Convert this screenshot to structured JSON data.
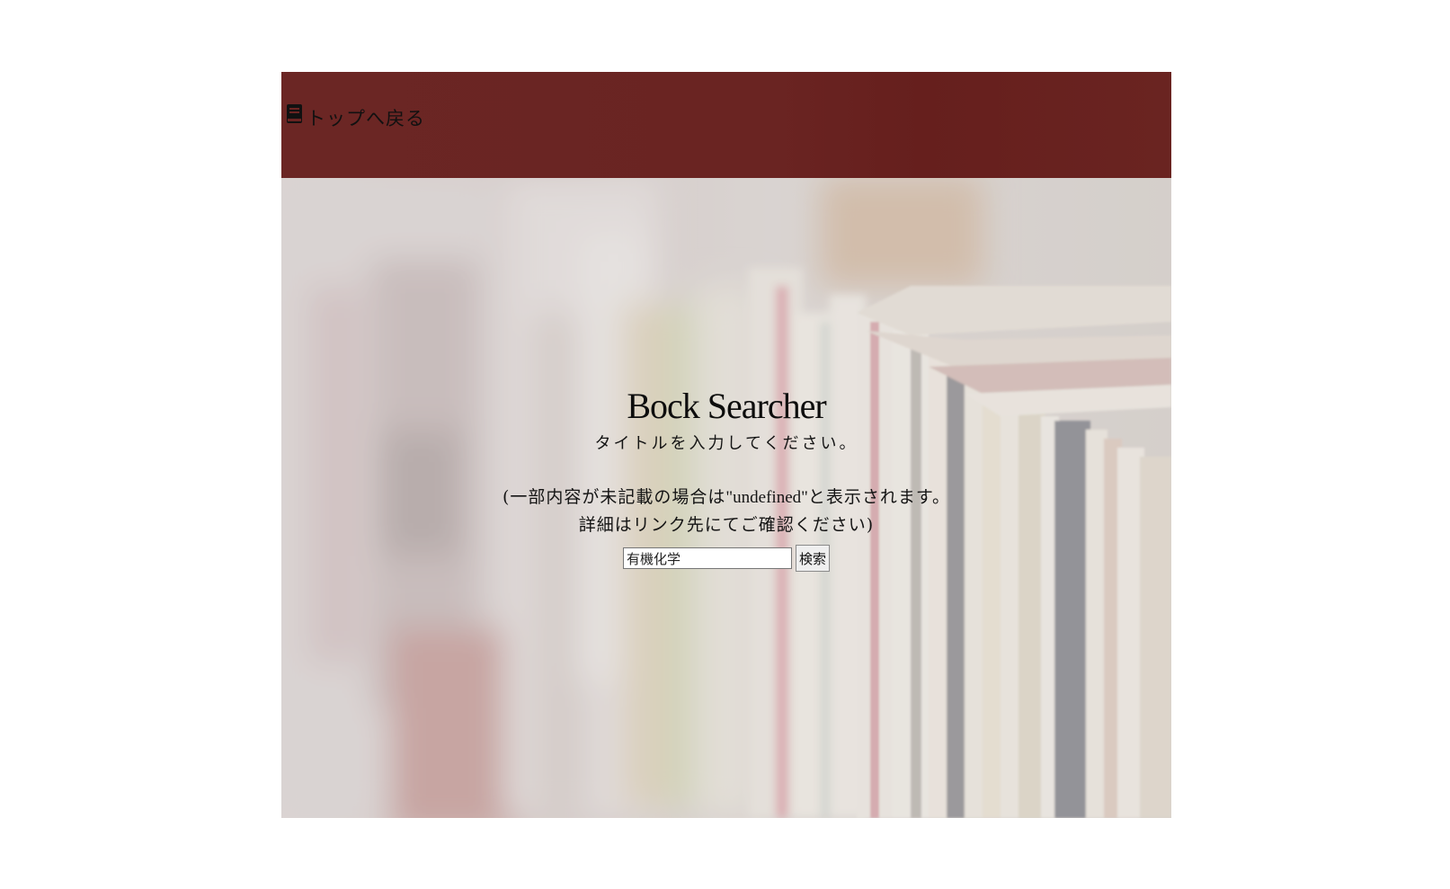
{
  "header": {
    "back_label": "トップへ戻る",
    "back_icon": "book-icon",
    "background_color": "#692422"
  },
  "main": {
    "title": "Bock Searcher",
    "prompt": "タイトルを入力してください。",
    "note_line1_pre": "(一部内容が未記載の場合は",
    "note_line1_mid": "\"undefined\"",
    "note_line1_post": "と表示されます。",
    "note_line2": "詳細はリンク先にてご確認ください)"
  },
  "search": {
    "input_value": "有機化学",
    "button_label": "検索"
  }
}
